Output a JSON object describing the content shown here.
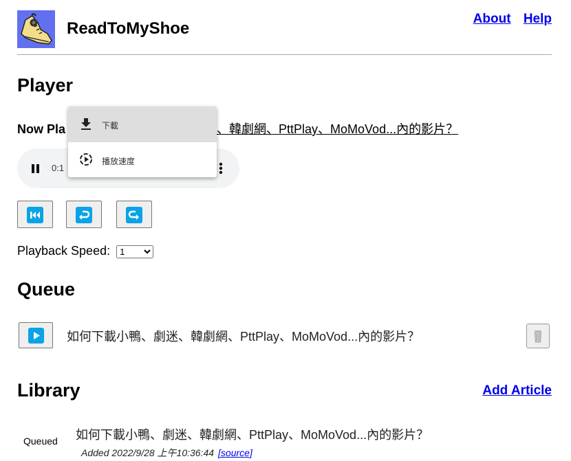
{
  "header": {
    "app_title": "ReadToMyShoe",
    "logo_icon": "sneaker-with-headphones-logo",
    "nav": [
      {
        "label": "About"
      },
      {
        "label": "Help"
      }
    ]
  },
  "player": {
    "heading": "Player",
    "now_playing_label": "Now Pla",
    "now_playing_visible_title": "迷、韓劇網、PttPlay、MoMoVod...內的影片？",
    "audio": {
      "state": "playing",
      "time": "0:1"
    },
    "context_menu": {
      "items": [
        {
          "label": "下載",
          "icon": "download-icon",
          "highlighted": true
        },
        {
          "label": "播放速度",
          "icon": "playback-speed-icon",
          "highlighted": false
        }
      ]
    },
    "controls": [
      {
        "name": "restart",
        "icon": "skip-back-icon"
      },
      {
        "name": "rewind",
        "icon": "rewind-arrow-icon"
      },
      {
        "name": "forward",
        "icon": "forward-arrow-icon"
      }
    ],
    "speed_label": "Playback Speed:",
    "speed_value": "1"
  },
  "queue": {
    "heading": "Queue",
    "items": [
      {
        "title": "如何下載小鴨、劇迷、韓劇網、PttPlay、MoMoVod...內的影片？"
      }
    ]
  },
  "library": {
    "heading": "Library",
    "add_article_label": "Add Article",
    "items": [
      {
        "status": "Queued",
        "title": "如何下載小鴨、劇迷、韓劇網、PttPlay、MoMoVod...內的影片？",
        "added": "Added 2022/9/28 上午10:36:44",
        "source_label": "[source]"
      }
    ]
  },
  "colors": {
    "accent_blue": "#0aa3e8",
    "logo_bg": "#6270f0",
    "link": "#0000ee"
  }
}
